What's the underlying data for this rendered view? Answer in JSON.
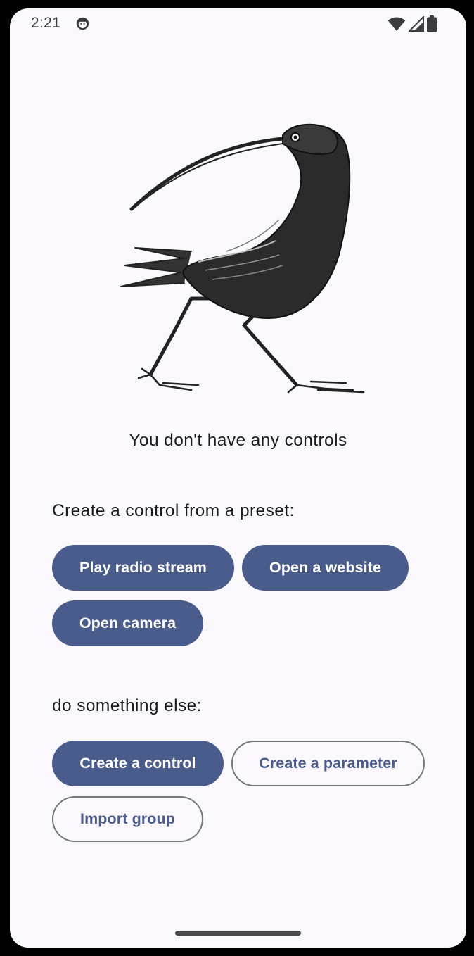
{
  "status_bar": {
    "time": "2:21",
    "app_icon": "android-debug-icon",
    "icons": [
      "wifi-icon",
      "cell-signal-icon",
      "battery-icon"
    ]
  },
  "illustration": {
    "icon": "curlew-bird-illustration"
  },
  "empty_state": {
    "message": "You don't have any controls"
  },
  "presets": {
    "label": "Create a control from a preset:",
    "buttons": [
      "Play radio stream",
      "Open a website",
      "Open camera"
    ]
  },
  "other": {
    "label": "do something else:",
    "buttons": [
      "Create a control",
      "Create a parameter",
      "Import group"
    ]
  },
  "colors": {
    "primary": "#4a5c8c",
    "background": "#faf8fd",
    "outline": "#74777f",
    "text": "#1b1b1f"
  }
}
